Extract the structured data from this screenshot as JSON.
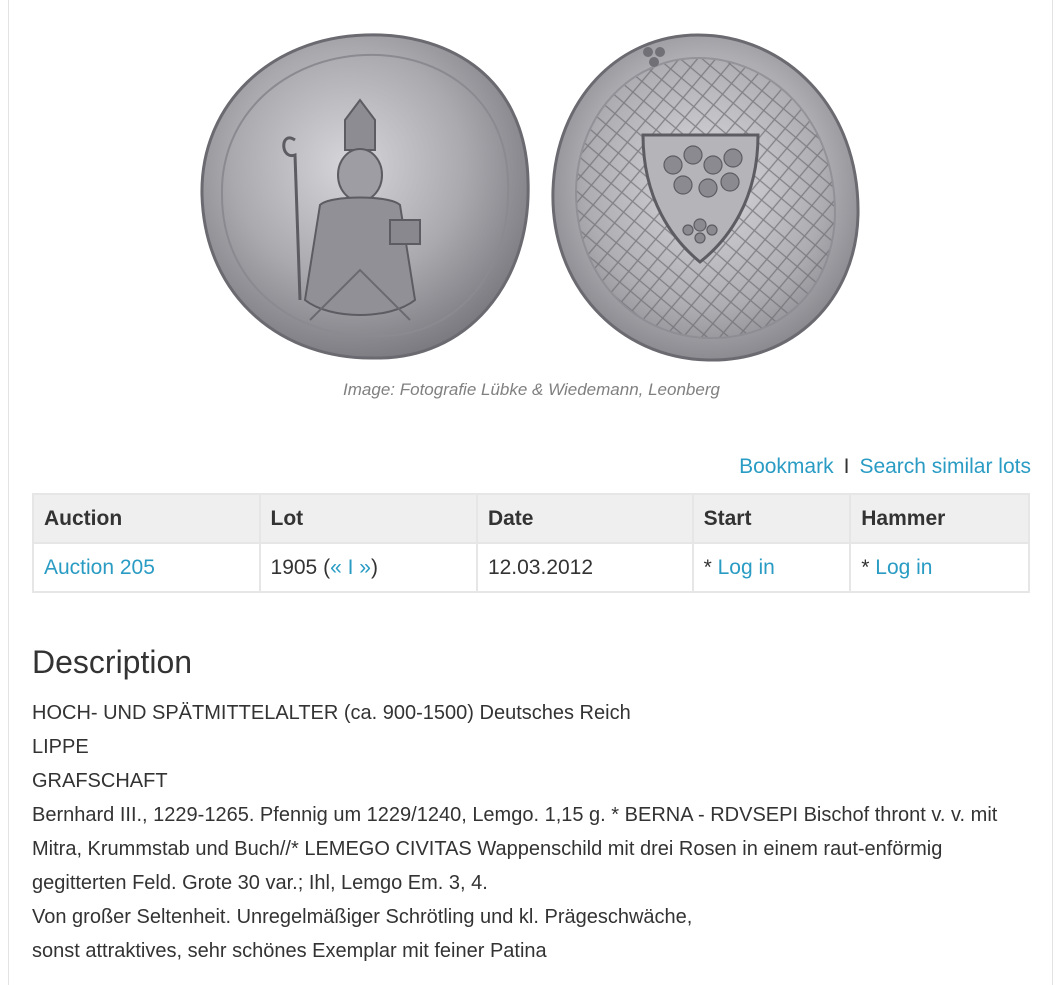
{
  "image": {
    "caption": "Image: Fotografie Lübke & Wiedemann, Leonberg"
  },
  "actions": {
    "bookmark": "Bookmark",
    "separator": "I",
    "search_similar": "Search similar lots"
  },
  "table": {
    "headers": [
      "Auction",
      "Lot",
      "Date",
      "Start",
      "Hammer"
    ],
    "row": {
      "auction": "Auction 205",
      "lot_number": "1905",
      "lot_paren_open": "(",
      "prev": "«",
      "lot_sep": "I",
      "next": "»",
      "lot_paren_close": ")",
      "date": "12.03.2012",
      "start_prefix": "* ",
      "start_link": "Log in",
      "hammer_prefix": "* ",
      "hammer_link": "Log in"
    }
  },
  "description": {
    "heading": "Description",
    "lines": [
      "HOCH- UND SPÄTMITTELALTER (ca. 900-1500) Deutsches Reich",
      "LIPPE",
      "GRAFSCHAFT",
      "Bernhard III., 1229-1265. Pfennig um 1229/1240, Lemgo. 1,15 g. * BERNA - RDVSEPI Bischof thront v. v. mit Mitra, Krummstab und Buch//* LEMEGO CIVITAS Wappenschild mit drei Rosen in einem raut-enförmig gegitterten Feld. Grote 30 var.; Ihl, Lemgo Em. 3, 4.",
      "Von großer Seltenheit. Unregelmäßiger Schrötling und kl. Prägeschwäche,",
      "sonst attraktives, sehr schönes Exemplar mit feiner Patina"
    ]
  },
  "colors": {
    "link": "#2a9cc4",
    "text": "#333333",
    "header_bg": "#efefef"
  }
}
